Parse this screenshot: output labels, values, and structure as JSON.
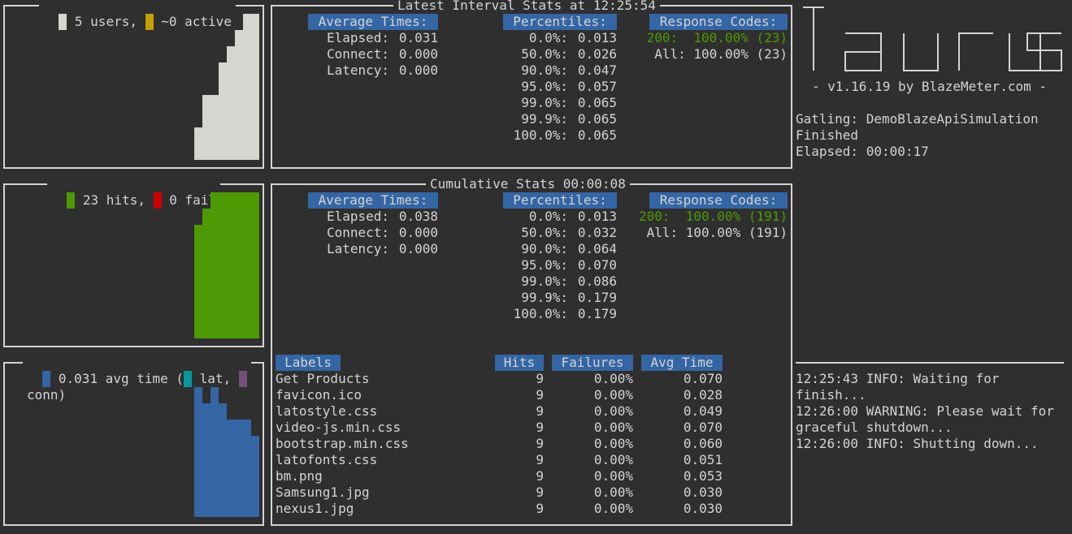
{
  "users_widget": {
    "users_label": "5 users,",
    "active_label": "~0 active",
    "colors": {
      "users": "#d3d7cf",
      "active": "#c4a000"
    },
    "levels": [
      0,
      0,
      0,
      0,
      0,
      0,
      0,
      0,
      0,
      0,
      0,
      0,
      0,
      0,
      0,
      0,
      0,
      0,
      0,
      0,
      0,
      0,
      2,
      4,
      4,
      6,
      7,
      8,
      9,
      9
    ]
  },
  "hits_widget": {
    "hits_label": "23 hits,",
    "fail_label": "0 fail",
    "colors": {
      "hits": "#4e9a06",
      "fail": "#cc0000"
    },
    "levels": [
      0,
      0,
      0,
      0,
      0,
      0,
      0,
      0,
      0,
      0,
      0,
      0,
      0,
      0,
      0,
      0,
      0,
      0,
      0,
      0,
      0,
      0,
      7,
      8,
      9,
      9,
      9,
      9,
      9,
      9
    ]
  },
  "time_widget": {
    "avg_label": "0.031 avg time (",
    "lat_label": "lat,",
    "conn_label": "conn)",
    "colors": {
      "avg": "#3465a4",
      "lat": "#06989a",
      "conn": "#75507b"
    },
    "levels": [
      0,
      0,
      0,
      0,
      0,
      0,
      0,
      0,
      0,
      0,
      0,
      0,
      0,
      0,
      0,
      0,
      0,
      0,
      0,
      0,
      0,
      0,
      8,
      7,
      8,
      7,
      6,
      6,
      6,
      5
    ]
  },
  "latest": {
    "title": "Latest Interval Stats at 12:25:54",
    "avg_header": "Average Times:",
    "avg": [
      {
        "label": "Elapsed:",
        "value": "0.031"
      },
      {
        "label": "Connect:",
        "value": "0.000"
      },
      {
        "label": "Latency:",
        "value": "0.000"
      }
    ],
    "pct_header": "Percentiles:",
    "pct": [
      {
        "p": "0.0%:",
        "v": "0.013"
      },
      {
        "p": "50.0%:",
        "v": "0.026"
      },
      {
        "p": "90.0%:",
        "v": "0.047"
      },
      {
        "p": "95.0%:",
        "v": "0.057"
      },
      {
        "p": "99.0%:",
        "v": "0.065"
      },
      {
        "p": "99.9%:",
        "v": "0.065"
      },
      {
        "p": "100.0%:",
        "v": "0.065"
      }
    ],
    "rc_header": "Response Codes:",
    "rc": [
      {
        "code": "200:",
        "value": "100.00% (23)",
        "ok": true
      },
      {
        "code": "All:",
        "value": "100.00% (23)",
        "ok": false
      }
    ]
  },
  "cumulative": {
    "title": "Cumulative Stats 00:00:08",
    "avg_header": "Average Times:",
    "avg": [
      {
        "label": "Elapsed:",
        "value": "0.038"
      },
      {
        "label": "Connect:",
        "value": "0.000"
      },
      {
        "label": "Latency:",
        "value": "0.000"
      }
    ],
    "pct_header": "Percentiles:",
    "pct": [
      {
        "p": "0.0%:",
        "v": "0.013"
      },
      {
        "p": "50.0%:",
        "v": "0.032"
      },
      {
        "p": "90.0%:",
        "v": "0.064"
      },
      {
        "p": "95.0%:",
        "v": "0.070"
      },
      {
        "p": "99.0%:",
        "v": "0.086"
      },
      {
        "p": "99.9%:",
        "v": "0.179"
      },
      {
        "p": "100.0%:",
        "v": "0.179"
      }
    ],
    "rc_header": "Response Codes:",
    "rc": [
      {
        "code": "200:",
        "value": "100.00% (191)",
        "ok": true
      },
      {
        "code": "All:",
        "value": "100.00% (191)",
        "ok": false
      }
    ],
    "table": {
      "headers": {
        "labels": "Labels",
        "hits": "Hits",
        "failures": "Failures",
        "avg": "Avg Time"
      },
      "rows": [
        {
          "label": "Get Products",
          "hits": "9",
          "failures": "0.00%",
          "avg": "0.070"
        },
        {
          "label": "favicon.ico",
          "hits": "9",
          "failures": "0.00%",
          "avg": "0.028"
        },
        {
          "label": "latostyle.css",
          "hits": "9",
          "failures": "0.00%",
          "avg": "0.049"
        },
        {
          "label": "video-js.min.css",
          "hits": "9",
          "failures": "0.00%",
          "avg": "0.070"
        },
        {
          "label": "bootstrap.min.css",
          "hits": "9",
          "failures": "0.00%",
          "avg": "0.060"
        },
        {
          "label": "latofonts.css",
          "hits": "9",
          "failures": "0.00%",
          "avg": "0.051"
        },
        {
          "label": "bm.png",
          "hits": "9",
          "failures": "0.00%",
          "avg": "0.053"
        },
        {
          "label": "Samsung1.jpg",
          "hits": "9",
          "failures": "0.00%",
          "avg": "0.030"
        },
        {
          "label": "nexus1.jpg",
          "hits": "9",
          "failures": "0.00%",
          "avg": "0.030"
        }
      ]
    }
  },
  "sidebar": {
    "logo_text": "Taurus",
    "version": "- v1.16.19 by BlazeMeter.com -",
    "executor_lines": [
      "Gatling: DemoBlazeApiSimulation",
      "Finished",
      "Elapsed: 00:00:17"
    ],
    "log_lines": [
      "12:25:43 INFO: Waiting for",
      "finish...",
      "12:26:00 WARNING: Please wait for",
      "graceful shutdown...",
      "12:26:00 INFO: Shutting down..."
    ]
  }
}
